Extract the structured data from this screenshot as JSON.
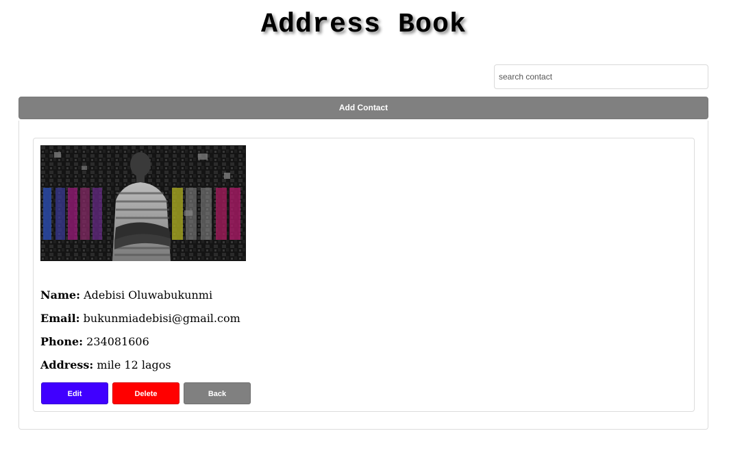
{
  "header": {
    "title": "Address Book"
  },
  "search": {
    "placeholder": "search contact",
    "value": ""
  },
  "toolbar": {
    "add_contact_label": "Add Contact"
  },
  "contact": {
    "photo_alt": "contact photo",
    "name_label": "Name:",
    "name_value": "Adebisi Oluwabukunmi",
    "email_label": "Email:",
    "email_value": "bukunmiadebisi@gmail.com",
    "phone_label": "Phone:",
    "phone_value": "234081606",
    "address_label": "Address:",
    "address_value": "mile 12 lagos"
  },
  "actions": {
    "edit_label": "Edit",
    "delete_label": "Delete",
    "back_label": "Back"
  },
  "colors": {
    "edit": "#4000ff",
    "delete": "#ff0000",
    "back": "#808080",
    "add_contact": "#808080"
  }
}
